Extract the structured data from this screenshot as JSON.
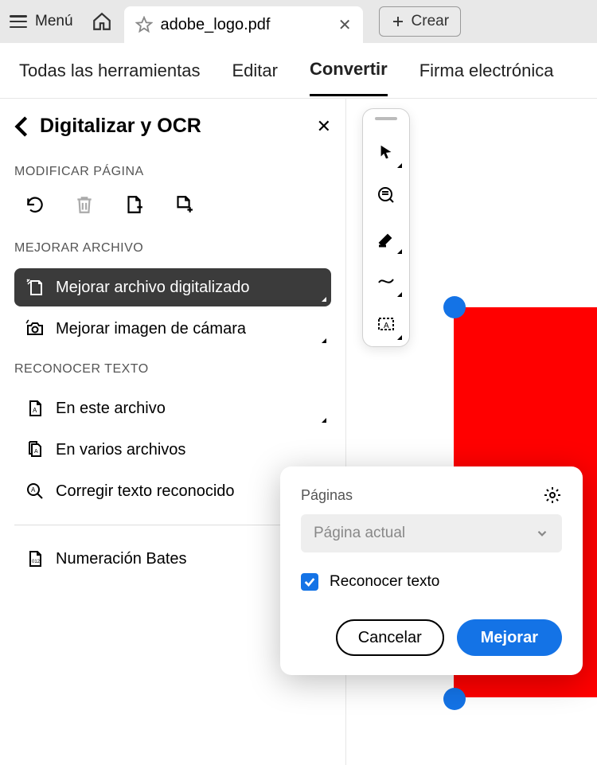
{
  "titlebar": {
    "menu_label": "Menú",
    "tab_title": "adobe_logo.pdf",
    "crear_label": "Crear"
  },
  "mainnav": {
    "tools": "Todas las herramientas",
    "edit": "Editar",
    "convert": "Convertir",
    "sign": "Firma electrónica"
  },
  "panel": {
    "title": "Digitalizar y OCR",
    "section_modify": "MODIFICAR PÁGINA",
    "section_enhance": "MEJORAR ARCHIVO",
    "section_recognize": "RECONOCER TEXTO",
    "enhance_scanned": "Mejorar archivo digitalizado",
    "enhance_camera": "Mejorar imagen de cámara",
    "in_this_file": "En este archivo",
    "in_multiple_files": "En varios archivos",
    "correct_text": "Corregir texto reconocido",
    "bates": "Numeración Bates"
  },
  "popup": {
    "pages_label": "Páginas",
    "pages_value": "Página actual",
    "recognize_label": "Reconocer texto",
    "cancel": "Cancelar",
    "enhance": "Mejorar"
  }
}
